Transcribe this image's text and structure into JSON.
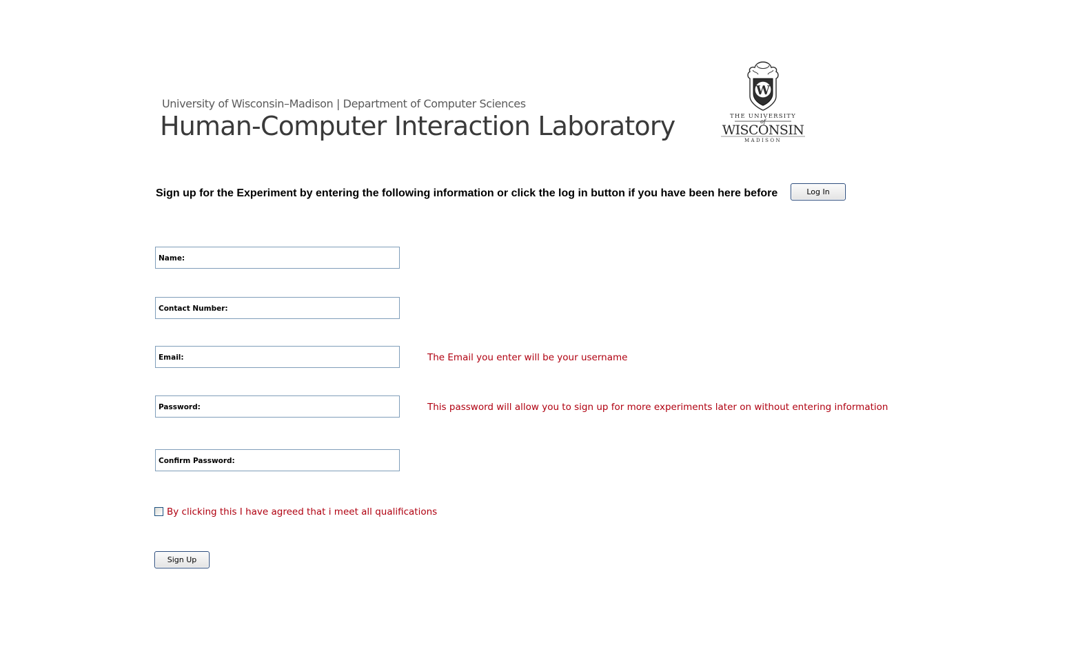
{
  "header": {
    "subtitle": "University of Wisconsin–Madison | Department of Computer Sciences",
    "title": "Human-Computer Interaction Laboratory",
    "logo": {
      "name": "uw-crest-logo",
      "line1": "THE UNIVERSITY",
      "line2": "of",
      "line3": "WISCONSIN",
      "line4": "MADISON",
      "crest_letter": "W"
    }
  },
  "instructions": {
    "text": "Sign up for the Experiment by entering the following information or click the log in button if you have been here before",
    "login_label": "Log In"
  },
  "form": {
    "fields": [
      {
        "label": "Name:",
        "value": ""
      },
      {
        "label": "Contact Number:",
        "value": ""
      },
      {
        "label": "Email:",
        "value": ""
      },
      {
        "label": "Password:",
        "value": ""
      },
      {
        "label": "Confirm Password:",
        "value": ""
      }
    ],
    "hints": {
      "email": "The Email you enter will be your username",
      "password": "This password will allow you to sign up for more experiments later on without entering information"
    },
    "agreement": {
      "checked": false,
      "label": "By clicking this I have agreed that i meet all qualifications"
    },
    "signup_label": "Sign Up"
  },
  "colors": {
    "hint_text": "#b00010",
    "field_border": "#7f9db9",
    "button_border": "#2a4a7a"
  }
}
